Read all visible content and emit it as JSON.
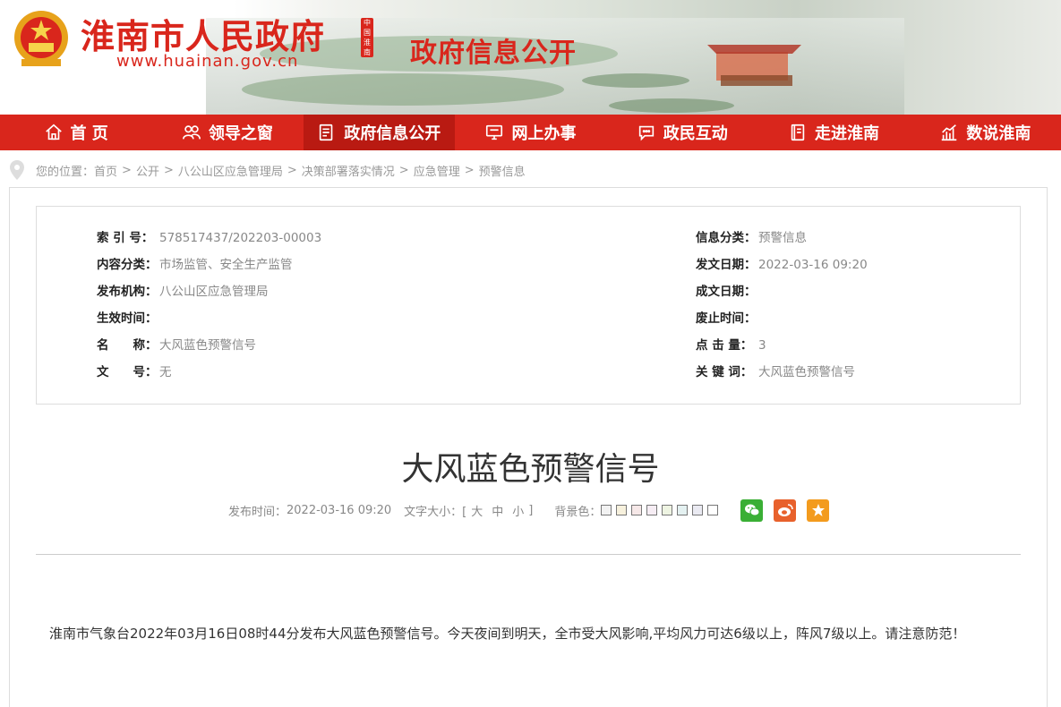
{
  "header": {
    "site_name": "淮南市人民政府",
    "site_url": "www.huainan.gov.cn",
    "seal_text": "中国淮南",
    "section_title": "政府信息公开"
  },
  "nav": [
    {
      "label": "首 页",
      "icon": "home-icon"
    },
    {
      "label": "领导之窗",
      "icon": "people-icon"
    },
    {
      "label": "政府信息公开",
      "icon": "document-icon",
      "active": true
    },
    {
      "label": "网上办事",
      "icon": "monitor-icon"
    },
    {
      "label": "政民互动",
      "icon": "chat-icon"
    },
    {
      "label": "走进淮南",
      "icon": "book-icon"
    },
    {
      "label": "数说淮南",
      "icon": "bar-chart-icon"
    }
  ],
  "breadcrumb": {
    "prefix": "您的位置：",
    "items": [
      "首页",
      "公开",
      "八公山区应急管理局",
      "决策部署落实情况",
      "应急管理",
      "预警信息"
    ],
    "sep": ">"
  },
  "meta": {
    "index_no": {
      "label": "索 引 号：",
      "value": "578517437/202203-00003"
    },
    "content_category": {
      "label": "内容分类：",
      "value": "市场监管、安全生产监管"
    },
    "publisher": {
      "label": "发布机构：",
      "value": "八公山区应急管理局"
    },
    "effective_time": {
      "label": "生效时间：",
      "value": ""
    },
    "name": {
      "label": "名　　称：",
      "value": "大风蓝色预警信号"
    },
    "doc_no": {
      "label": "文　　号：",
      "value": "无"
    },
    "info_category": {
      "label": "信息分类：",
      "value": "预警信息"
    },
    "issue_date": {
      "label": "发文日期：",
      "value": "2022-03-16 09:20"
    },
    "written_date": {
      "label": "成文日期：",
      "value": ""
    },
    "expire_time": {
      "label": "废止时间：",
      "value": ""
    },
    "clicks": {
      "label": "点 击 量：",
      "value": "3"
    },
    "keywords": {
      "label": "关 键 词：",
      "value": "大风蓝色预警信号"
    }
  },
  "article": {
    "title": "大风蓝色预警信号",
    "publish_label": "发布时间：",
    "publish_time": "2022-03-16 09:20",
    "font_size_label": "文字大小：[",
    "font_size_close": "]",
    "font_sizes": [
      "大",
      "中",
      "小"
    ],
    "bg_label": "背景色：",
    "bg_colors": [
      "#f2f2f2",
      "#f7f1dd",
      "#f6e8e8",
      "#f6edf4",
      "#eef4e2",
      "#e4f1f1",
      "#eaeaf2",
      "#ffffff"
    ],
    "share": [
      {
        "icon": "wechat-icon",
        "color": "#3aaf35"
      },
      {
        "icon": "weibo-icon",
        "color": "#e8612c"
      },
      {
        "icon": "favorite-icon",
        "color": "#f39b1e"
      }
    ],
    "body": "淮南市气象台2022年03月16日08时44分发布大风蓝色预警信号。今天夜间到明天，全市受大风影响,平均风力可达6级以上，阵风7级以上。请注意防范！"
  },
  "colors": {
    "brand_red": "#d9261c",
    "nav_active": "#b91a12"
  }
}
